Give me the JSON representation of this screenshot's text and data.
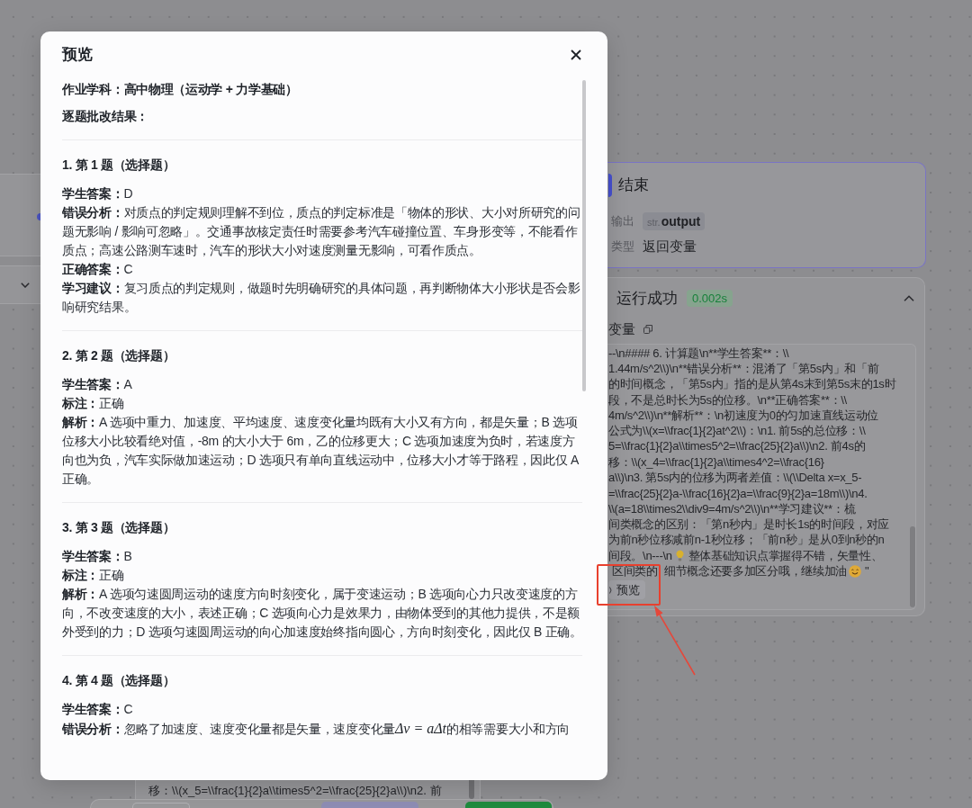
{
  "canvas": {
    "end_node": {
      "title": "结束",
      "rows": [
        {
          "kind": "tag",
          "label": "输出",
          "prefix": "str.",
          "value": "output"
        },
        {
          "kind": "text",
          "label": "类型",
          "value": "返回变量"
        }
      ]
    },
    "run_panel": {
      "status": "运行成功",
      "duration": "0.002s",
      "expanded": true,
      "section_label": "变量",
      "output_lines": [
        {
          "kind": "text",
          "text": "--\\n#### 6. 计算题\\n**学生答案**：\\\\"
        },
        {
          "kind": "text",
          "text": "1.44m/s^2\\\\)\\n**错误分析**：混淆了「第5s内」和「前"
        },
        {
          "kind": "text",
          "text": "的时间概念，「第5s内」指的是从第4s末到第5s末的1s时"
        },
        {
          "kind": "text",
          "text": "段，不是总时长为5s的位移。\\n**正确答案**：\\\\"
        },
        {
          "kind": "text",
          "text": "4m/s^2\\\\)\\n**解析**：\\n初速度为0的匀加速直线运动位"
        },
        {
          "kind": "text",
          "text": "公式为\\\\(x=\\\\frac{1}{2}at^2\\\\)：\\n1. 前5s的总位移：\\\\"
        },
        {
          "kind": "text",
          "text": "5=\\\\frac{1}{2}a\\\\times5^2=\\\\frac{25}{2}a\\\\)\\n2. 前4s的"
        },
        {
          "kind": "text",
          "text": "移：\\\\(x_4=\\\\frac{1}{2}a\\\\times4^2=\\\\frac{16}"
        },
        {
          "kind": "text",
          "text": "a\\\\)\\n3. 第5s内的位移为两者差值：\\\\(\\\\Delta x=x_5-"
        },
        {
          "kind": "text",
          "text": "=\\\\frac{25}{2}a-\\\\frac{16}{2}a=\\\\frac{9}{2}a=18m\\\\)\\n4."
        },
        {
          "kind": "text",
          "text": "\\\\(a=18\\\\times2\\\\div9=4m/s^2\\\\)\\n**学习建议**：梳"
        },
        {
          "kind": "text",
          "text": "间类概念的区别：「第n秒内」是时长1s的时间段，对应"
        },
        {
          "kind": "text",
          "text": "为前n秒位移减前n-1秒位移；「前n秒」是从0到n秒的n"
        },
        {
          "kind": "bulb",
          "text": "间段。\\n---\\n",
          "tail": "整体基础知识点掌握得不错，矢量性、"
        },
        {
          "kind": "smile",
          "parts": [
            "区间类的",
            "细节概念还要多加区分哦，继续加油"
          ],
          "tail": "\""
        }
      ],
      "preview_button": "预览"
    },
    "lower_output": {
      "lines": [
        "移：\\\\(x_5=\\\\frac{1}{2}a\\\\times5^2=\\\\frac{25}{2}a\\\\)\\n2. 前"
      ]
    }
  },
  "modal": {
    "title": "预览",
    "subject": "作业学科：高中物理（运动学 + 力学基础）",
    "results_heading": "逐题批改结果：",
    "questions": [
      {
        "heading": "1. 第 1 题（选择题）",
        "fields": [
          {
            "label": "学生答案：",
            "text": "D"
          },
          {
            "label": "错误分析：",
            "text": "对质点的判定规则理解不到位，质点的判定标准是「物体的形状、大小对所研究的问题无影响 / 影响可忽略」。交通事故核定责任时需要参考汽车碰撞位置、车身形变等，不能看作质点；高速公路测车速时，汽车的形状大小对速度测量无影响，可看作质点。"
          },
          {
            "label": "正确答案：",
            "text": "C"
          },
          {
            "label": "学习建议：",
            "text": "复习质点的判定规则，做题时先明确研究的具体问题，再判断物体大小形状是否会影响研究结果。"
          }
        ]
      },
      {
        "heading": "2. 第 2 题（选择题）",
        "fields": [
          {
            "label": "学生答案：",
            "text": "A"
          },
          {
            "label": "标注：",
            "text": "正确"
          },
          {
            "label": "解析：",
            "text": "A 选项中重力、加速度、平均速度、速度变化量均既有大小又有方向，都是矢量；B 选项位移大小比较看绝对值，-8m 的大小大于 6m，乙的位移更大；C 选项加速度为负时，若速度方向也为负，汽车实际做加速运动；D 选项只有单向直线运动中，位移大小才等于路程，因此仅 A 正确。"
          }
        ]
      },
      {
        "heading": "3. 第 3 题（选择题）",
        "fields": [
          {
            "label": "学生答案：",
            "text": "B"
          },
          {
            "label": "标注：",
            "text": "正确"
          },
          {
            "label": "解析：",
            "text": "A 选项匀速圆周运动的速度方向时刻变化，属于变速运动；B 选项向心力只改变速度的方向，不改变速度的大小，表述正确；C 选项向心力是效果力，由物体受到的其他力提供，不是额外受到的力；D 选项匀速圆周运动的向心加速度始终指向圆心，方向时刻变化，因此仅 B 正确。"
          }
        ]
      },
      {
        "heading": "4. 第 4 题（选择题）",
        "fields": [
          {
            "label": "学生答案：",
            "text": "C"
          },
          {
            "label": "错误分析：",
            "text": "忽略了加速度、速度变化量都是矢量，速度变化量",
            "math": "Δv = aΔt",
            "text_after": "的相等需要大小和方向"
          }
        ]
      }
    ]
  }
}
